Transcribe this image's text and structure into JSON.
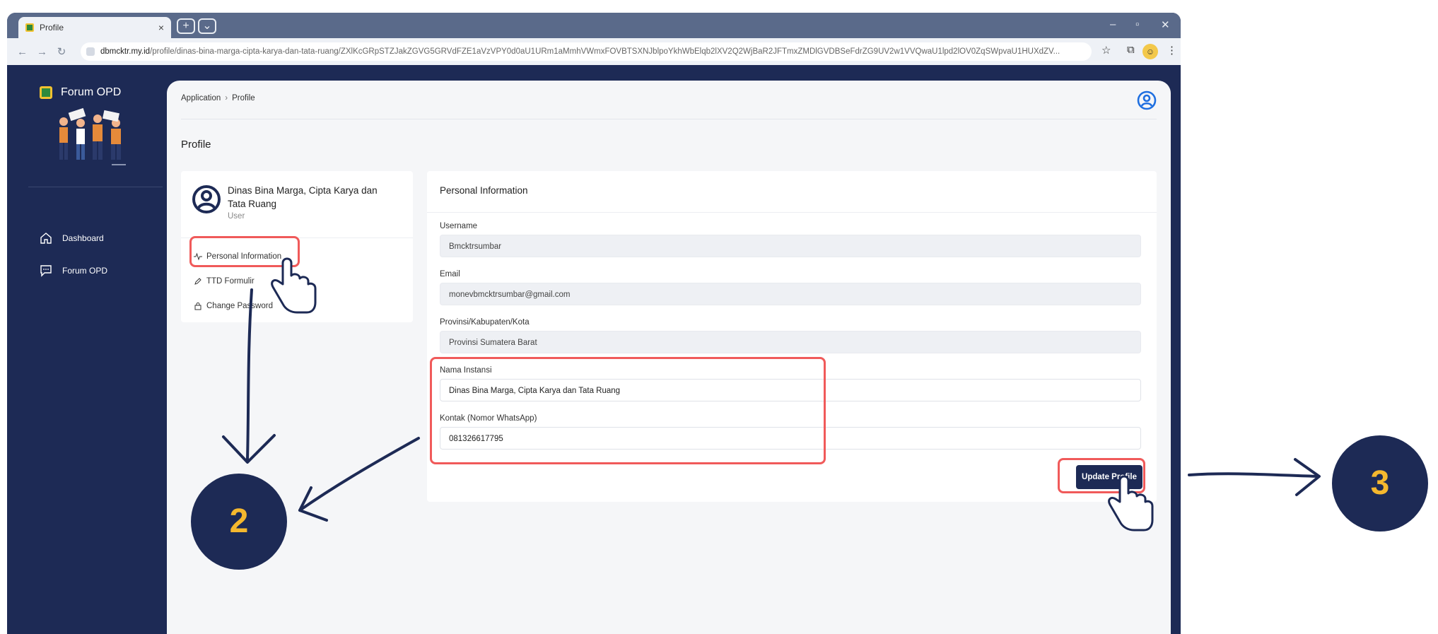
{
  "browser": {
    "tab_title": "Profile",
    "url_domain": "dbmcktr.my.id",
    "url_path": "/profile/dinas-bina-marga-cipta-karya-dan-tata-ruang/ZXlKcGRpSTZJakZGVG5GRVdFZE1aVzVPY0d0aU1URm1aMmhVWmxFOVBTSXNJblpoYkhWbElqb2lXV2Q2WjBaR2JFTmxZMDlGVDBSeFdrZG9UV2w1VVQwaU1lpd2lOV0ZqSWpvaU1HUXdZV..."
  },
  "sidebar": {
    "brand": "Forum OPD",
    "items": [
      {
        "label": "Dashboard",
        "icon": "home-icon"
      },
      {
        "label": "Forum OPD",
        "icon": "chat-icon"
      }
    ]
  },
  "breadcrumb": [
    "Application",
    "Profile"
  ],
  "page_title": "Profile",
  "user_card": {
    "name": "Dinas Bina Marga, Cipta Karya dan Tata Ruang",
    "role": "User",
    "menu": [
      {
        "label": "Personal Information",
        "icon": "activity-icon"
      },
      {
        "label": "TTD Formulir",
        "icon": "pen-icon"
      },
      {
        "label": "Change Password",
        "icon": "lock-icon"
      }
    ]
  },
  "form": {
    "title": "Personal Information",
    "fields": [
      {
        "label": "Username",
        "value": "Bmcktrsumbar"
      },
      {
        "label": "Email",
        "value": "monevbmcktrsumbar@gmail.com"
      },
      {
        "label": "Provinsi/Kabupaten/Kota",
        "value": "Provinsi Sumatera Barat"
      },
      {
        "label": "Nama Instansi",
        "value": "Dinas Bina Marga, Cipta Karya dan Tata Ruang"
      },
      {
        "label": "Kontak (Nomor WhatsApp)",
        "value": "081326617795"
      }
    ],
    "submit_label": "Update Profile"
  },
  "annotations": {
    "step_2": "2",
    "step_3": "3"
  },
  "colors": {
    "navy": "#1d2a55",
    "highlight": "#f05a5a",
    "step_number": "#f5b82e"
  }
}
